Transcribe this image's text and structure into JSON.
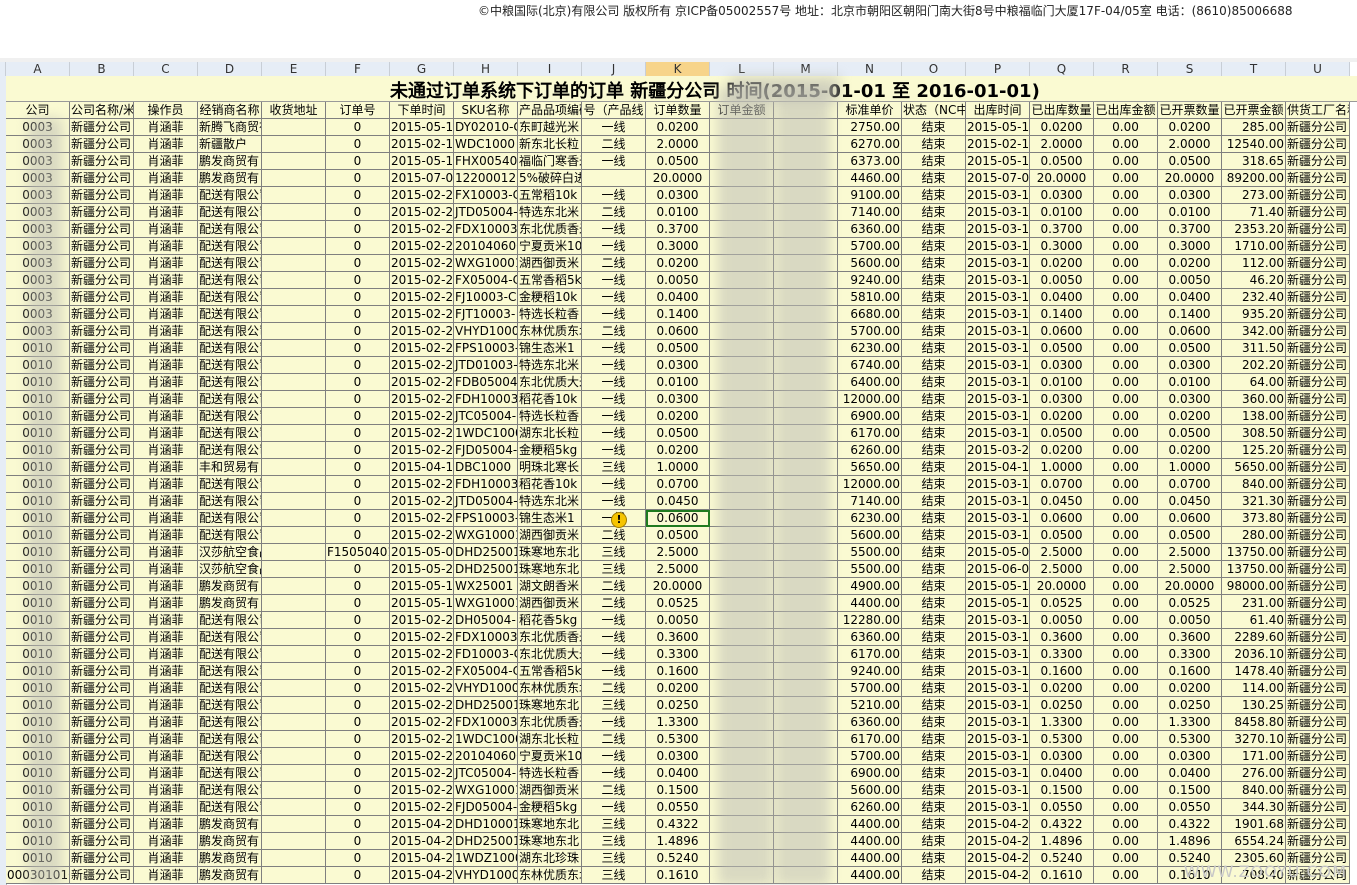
{
  "footer": "©中粮国际(北京)有限公司    版权所有    京ICP备05002557号    地址：北京市朝阳区朝阳门南大街8号中粮福临门大厦17F-04/05室    电话：(8610)85006688",
  "columns": [
    "A",
    "B",
    "C",
    "D",
    "E",
    "F",
    "G",
    "H",
    "I",
    "J",
    "K",
    "L",
    "M",
    "N",
    "O",
    "P",
    "Q",
    "R",
    "S",
    "T",
    "U"
  ],
  "selected_column": "K",
  "sheet_title": "未通过订单系统下订单的订单 新疆分公司 时间(2015-01-01 至 2016-01-01)",
  "headers": [
    "公司",
    "公司名称/米",
    "操作员",
    "经销商名称",
    "收货地址",
    "订单号",
    "下单时间",
    "SKU名称",
    "产品品项编码",
    "号（产品线",
    "订单数量",
    "订单金额",
    "",
    "标准单价",
    "状态（NC中",
    "出库时间",
    "已出库数量",
    "已出库金额",
    "已开票数量",
    "已开票金额",
    "供货工厂名称"
  ],
  "rows": [
    [
      "0003",
      "新疆分公司",
      "肖涵菲",
      "新腾飞商贸有",
      "",
      "0",
      "2015-05-14",
      "DY02010-C",
      "东町越光米",
      "一线",
      "0.0200",
      "",
      "",
      "2750.00",
      "结束",
      "2015-05-14",
      "0.0200",
      "0.00",
      "0.0200",
      "285.00",
      "新疆分公司"
    ],
    [
      "0003",
      "新疆分公司",
      "肖涵菲",
      "新疆散户",
      "",
      "0",
      "2015-02-10",
      "WDC1000",
      "新东北长粒",
      "二线",
      "2.0000",
      "",
      "",
      "6270.00",
      "结束",
      "2015-02-11",
      "2.0000",
      "0.00",
      "2.0000",
      "12540.00",
      "新疆分公司"
    ],
    [
      "0003",
      "新疆分公司",
      "肖涵菲",
      "鹏发商贸有",
      "",
      "0",
      "2015-05-12",
      "FHX00540",
      "福临门寒香米",
      "一线",
      "0.0500",
      "",
      "",
      "6373.00",
      "结束",
      "2015-05-13",
      "0.0500",
      "0.00",
      "0.0500",
      "318.65",
      "新疆分公司"
    ],
    [
      "0003",
      "新疆分公司",
      "肖涵菲",
      "鹏发商贸有",
      "",
      "0",
      "2015-07-01",
      "12200012",
      "5%破碎白进口米贸易",
      "",
      "20.0000",
      "",
      "",
      "4460.00",
      "结束",
      "2015-07-01",
      "20.0000",
      "0.00",
      "20.0000",
      "89200.00",
      "新疆分公司"
    ],
    [
      "0003",
      "新疆分公司",
      "肖涵菲",
      "配送有限公司",
      "",
      "0",
      "2015-02-28",
      "FX10003-C",
      "五常稻10k",
      "一线",
      "0.0300",
      "",
      "",
      "9100.00",
      "结束",
      "2015-03-18",
      "0.0300",
      "0.00",
      "0.0300",
      "273.00",
      "新疆分公司"
    ],
    [
      "0003",
      "新疆分公司",
      "肖涵菲",
      "配送有限公司",
      "",
      "0",
      "2015-02-28",
      "JTD05004-",
      "特选东北米",
      "二线",
      "0.0100",
      "",
      "",
      "7140.00",
      "结束",
      "2015-03-18",
      "0.0100",
      "0.00",
      "0.0100",
      "71.40",
      "新疆分公司"
    ],
    [
      "0003",
      "新疆分公司",
      "肖涵菲",
      "配送有限公司",
      "",
      "0",
      "2015-02-28",
      "FDX10003-",
      "东北优质香米",
      "一线",
      "0.3700",
      "",
      "",
      "6360.00",
      "结束",
      "2015-03-18",
      "0.3700",
      "0.00",
      "0.3700",
      "2353.20",
      "新疆分公司"
    ],
    [
      "0003",
      "新疆分公司",
      "肖涵菲",
      "配送有限公司",
      "",
      "0",
      "2015-02-28",
      "201040600",
      "宁夏贡米10",
      "一线",
      "0.3000",
      "",
      "",
      "5700.00",
      "结束",
      "2015-03-18",
      "0.3000",
      "0.00",
      "0.3000",
      "1710.00",
      "新疆分公司"
    ],
    [
      "0003",
      "新疆分公司",
      "肖涵菲",
      "配送有限公司",
      "",
      "0",
      "2015-02-28",
      "WXG10001",
      "湖西御贡米",
      "二线",
      "0.0200",
      "",
      "",
      "5600.00",
      "结束",
      "2015-03-18",
      "0.0200",
      "0.00",
      "0.0200",
      "112.00",
      "新疆分公司"
    ],
    [
      "0003",
      "新疆分公司",
      "肖涵菲",
      "配送有限公司",
      "",
      "0",
      "2015-02-28",
      "FX05004-C",
      "五常香稻5kg",
      "一线",
      "0.0050",
      "",
      "",
      "9240.00",
      "结束",
      "2015-03-18",
      "0.0050",
      "0.00",
      "0.0050",
      "46.20",
      "新疆分公司"
    ],
    [
      "0003",
      "新疆分公司",
      "肖涵菲",
      "配送有限公司",
      "",
      "0",
      "2015-02-28",
      "FJ10003-C",
      "金粳稻10k",
      "一线",
      "0.0400",
      "",
      "",
      "5810.00",
      "结束",
      "2015-03-18",
      "0.0400",
      "0.00",
      "0.0400",
      "232.40",
      "新疆分公司"
    ],
    [
      "0003",
      "新疆分公司",
      "肖涵菲",
      "配送有限公司",
      "",
      "0",
      "2015-02-28",
      "FJT10003-",
      "特选长粒香",
      "一线",
      "0.1400",
      "",
      "",
      "6680.00",
      "结束",
      "2015-03-18",
      "0.1400",
      "0.00",
      "0.1400",
      "935.20",
      "新疆分公司"
    ],
    [
      "0003",
      "新疆分公司",
      "肖涵菲",
      "配送有限公司",
      "",
      "0",
      "2015-02-28",
      "VHYD1000",
      "东林优质东北",
      "二线",
      "0.0600",
      "",
      "",
      "5700.00",
      "结束",
      "2015-03-18",
      "0.0600",
      "0.00",
      "0.0600",
      "342.00",
      "新疆分公司"
    ],
    [
      "0010",
      "新疆分公司",
      "肖涵菲",
      "配送有限公司",
      "",
      "0",
      "2015-02-28",
      "FPS10003-",
      "锦生态米1",
      "一线",
      "0.0500",
      "",
      "",
      "6230.00",
      "结束",
      "2015-03-18",
      "0.0500",
      "0.00",
      "0.0500",
      "311.50",
      "新疆分公司"
    ],
    [
      "0010",
      "新疆分公司",
      "肖涵菲",
      "配送有限公司",
      "",
      "0",
      "2015-02-28",
      "JTD01003-",
      "特选东北米",
      "一线",
      "0.0300",
      "",
      "",
      "6740.00",
      "结束",
      "2015-03-18",
      "0.0300",
      "0.00",
      "0.0300",
      "202.20",
      "新疆分公司"
    ],
    [
      "0010",
      "新疆分公司",
      "肖涵菲",
      "配送有限公司",
      "",
      "0",
      "2015-02-28",
      "FDB05004",
      "东北优质大米",
      "一线",
      "0.0100",
      "",
      "",
      "6400.00",
      "结束",
      "2015-03-18",
      "0.0100",
      "0.00",
      "0.0100",
      "64.00",
      "新疆分公司"
    ],
    [
      "0010",
      "新疆分公司",
      "肖涵菲",
      "配送有限公司",
      "",
      "0",
      "2015-02-28",
      "FDH10003-",
      "稻花香10k",
      "一线",
      "0.0300",
      "",
      "",
      "12000.00",
      "结束",
      "2015-03-18",
      "0.0300",
      "0.00",
      "0.0300",
      "360.00",
      "新疆分公司"
    ],
    [
      "0010",
      "新疆分公司",
      "肖涵菲",
      "配送有限公司",
      "",
      "0",
      "2015-02-28",
      "JTC05004-",
      "特选长粒香",
      "一线",
      "0.0200",
      "",
      "",
      "6900.00",
      "结束",
      "2015-03-18",
      "0.0200",
      "0.00",
      "0.0200",
      "138.00",
      "新疆分公司"
    ],
    [
      "0010",
      "新疆分公司",
      "肖涵菲",
      "配送有限公司",
      "",
      "0",
      "2015-02-28",
      "1WDC1000",
      "湖东北长粒",
      "一线",
      "0.0500",
      "",
      "",
      "6170.00",
      "结束",
      "2015-03-18",
      "0.0500",
      "0.00",
      "0.0500",
      "308.50",
      "新疆分公司"
    ],
    [
      "0010",
      "新疆分公司",
      "肖涵菲",
      "配送有限公司",
      "",
      "0",
      "2015-02-28",
      "FJD05004-",
      "金粳稻5kg",
      "一线",
      "0.0200",
      "",
      "",
      "6260.00",
      "结束",
      "2015-03-24",
      "0.0200",
      "0.00",
      "0.0200",
      "125.20",
      "新疆分公司"
    ],
    [
      "0010",
      "新疆分公司",
      "肖涵菲",
      "丰和贸易有",
      "",
      "0",
      "2015-04-16",
      "DBC1000",
      "明珠北寒长",
      "三线",
      "1.0000",
      "",
      "",
      "5650.00",
      "结束",
      "2015-04-17",
      "1.0000",
      "0.00",
      "1.0000",
      "5650.00",
      "新疆分公司"
    ],
    [
      "0010",
      "新疆分公司",
      "肖涵菲",
      "配送有限公司",
      "",
      "0",
      "2015-02-28",
      "FDH10003-",
      "稻花香10k",
      "一线",
      "0.0700",
      "",
      "",
      "12000.00",
      "结束",
      "2015-03-18",
      "0.0700",
      "0.00",
      "0.0700",
      "840.00",
      "新疆分公司"
    ],
    [
      "0010",
      "新疆分公司",
      "肖涵菲",
      "配送有限公司",
      "",
      "0",
      "2015-02-28",
      "JTD05004-",
      "特选东北米",
      "一线",
      "0.0450",
      "",
      "",
      "7140.00",
      "结束",
      "2015-03-18",
      "0.0450",
      "0.00",
      "0.0450",
      "321.30",
      "新疆分公司"
    ],
    [
      "0010",
      "新疆分公司",
      "肖涵菲",
      "配送有限公司",
      "",
      "0",
      "2015-02-28",
      "FPS10003-",
      "锦生态米1",
      "一线",
      "0.0600",
      "",
      "",
      "6230.00",
      "结束",
      "2015-03-18",
      "0.0600",
      "0.00",
      "0.0600",
      "373.80",
      "新疆分公司"
    ],
    [
      "0010",
      "新疆分公司",
      "肖涵菲",
      "配送有限公司",
      "",
      "0",
      "2015-02-28",
      "WXG10001",
      "湖西御贡米",
      "二线",
      "0.0500",
      "",
      "",
      "5600.00",
      "结束",
      "2015-03-18",
      "0.0500",
      "0.00",
      "0.0500",
      "280.00",
      "新疆分公司"
    ],
    [
      "0010",
      "新疆分公司",
      "肖涵菲",
      "汉莎航空食品",
      "",
      "F15050401",
      "2015-05-04",
      "DHD25001",
      "珠寒地东北",
      "三线",
      "2.5000",
      "",
      "",
      "5500.00",
      "结束",
      "2015-05-07",
      "2.5000",
      "0.00",
      "2.5000",
      "13750.00",
      "新疆分公司"
    ],
    [
      "0010",
      "新疆分公司",
      "肖涵菲",
      "汉莎航空食品",
      "",
      "0",
      "2015-05-29",
      "DHD25001",
      "珠寒地东北",
      "三线",
      "2.5000",
      "",
      "",
      "5500.00",
      "结束",
      "2015-06-01",
      "2.5000",
      "0.00",
      "2.5000",
      "13750.00",
      "新疆分公司"
    ],
    [
      "0010",
      "新疆分公司",
      "肖涵菲",
      "鹏发商贸有",
      "",
      "0",
      "2015-05-15",
      "WX25001",
      "湖文朗香米",
      "二线",
      "20.0000",
      "",
      "",
      "4900.00",
      "结束",
      "2015-05-19",
      "20.0000",
      "0.00",
      "20.0000",
      "98000.00",
      "新疆分公司"
    ],
    [
      "0010",
      "新疆分公司",
      "肖涵菲",
      "鹏发商贸有",
      "",
      "0",
      "2015-05-13",
      "WXG10001",
      "湖西御贡米",
      "二线",
      "0.0525",
      "",
      "",
      "4400.00",
      "结束",
      "2015-05-13",
      "0.0525",
      "0.00",
      "0.0525",
      "231.00",
      "新疆分公司"
    ],
    [
      "0010",
      "新疆分公司",
      "肖涵菲",
      "配送有限公司",
      "",
      "0",
      "2015-02-28",
      "DH05004-",
      "稻花香5kg",
      "一线",
      "0.0050",
      "",
      "",
      "12280.00",
      "结束",
      "2015-03-18",
      "0.0050",
      "0.00",
      "0.0050",
      "61.40",
      "新疆分公司"
    ],
    [
      "0010",
      "新疆分公司",
      "肖涵菲",
      "配送有限公司",
      "",
      "0",
      "2015-02-28",
      "FDX10003-",
      "东北优质香米",
      "一线",
      "0.3600",
      "",
      "",
      "6360.00",
      "结束",
      "2015-03-18",
      "0.3600",
      "0.00",
      "0.3600",
      "2289.60",
      "新疆分公司"
    ],
    [
      "0010",
      "新疆分公司",
      "肖涵菲",
      "配送有限公司",
      "",
      "0",
      "2015-02-28",
      "FD10003-C",
      "东北优质大米",
      "一线",
      "0.3300",
      "",
      "",
      "6170.00",
      "结束",
      "2015-03-18",
      "0.3300",
      "0.00",
      "0.3300",
      "2036.10",
      "新疆分公司"
    ],
    [
      "0010",
      "新疆分公司",
      "肖涵菲",
      "配送有限公司",
      "",
      "0",
      "2015-02-28",
      "FX05004-C",
      "五常香稻5kg",
      "一线",
      "0.1600",
      "",
      "",
      "9240.00",
      "结束",
      "2015-03-18",
      "0.1600",
      "0.00",
      "0.1600",
      "1478.40",
      "新疆分公司"
    ],
    [
      "0010",
      "新疆分公司",
      "肖涵菲",
      "配送有限公司",
      "",
      "0",
      "2015-02-28",
      "VHYD1000",
      "东林优质东北",
      "二线",
      "0.0200",
      "",
      "",
      "5700.00",
      "结束",
      "2015-03-18",
      "0.0200",
      "0.00",
      "0.0200",
      "114.00",
      "新疆分公司"
    ],
    [
      "0010",
      "新疆分公司",
      "肖涵菲",
      "配送有限公司",
      "",
      "0",
      "2015-02-28",
      "DHD25001",
      "珠寒地东北",
      "三线",
      "0.0250",
      "",
      "",
      "5210.00",
      "结束",
      "2015-03-18",
      "0.0250",
      "0.00",
      "0.0250",
      "130.25",
      "新疆分公司"
    ],
    [
      "0010",
      "新疆分公司",
      "肖涵菲",
      "配送有限公司",
      "",
      "0",
      "2015-02-28",
      "FDX10003-",
      "东北优质香米",
      "一线",
      "1.3300",
      "",
      "",
      "6360.00",
      "结束",
      "2015-03-18",
      "1.3300",
      "0.00",
      "1.3300",
      "8458.80",
      "新疆分公司"
    ],
    [
      "0010",
      "新疆分公司",
      "肖涵菲",
      "配送有限公司",
      "",
      "0",
      "2015-02-28",
      "1WDC1000",
      "湖东北长粒",
      "二线",
      "0.5300",
      "",
      "",
      "6170.00",
      "结束",
      "2015-03-18",
      "0.5300",
      "0.00",
      "0.5300",
      "3270.10",
      "新疆分公司"
    ],
    [
      "0010",
      "新疆分公司",
      "肖涵菲",
      "配送有限公司",
      "",
      "0",
      "2015-02-28",
      "201040600",
      "宁夏贡米10",
      "一线",
      "0.0300",
      "",
      "",
      "5700.00",
      "结束",
      "2015-03-18",
      "0.0300",
      "0.00",
      "0.0300",
      "171.00",
      "新疆分公司"
    ],
    [
      "0010",
      "新疆分公司",
      "肖涵菲",
      "配送有限公司",
      "",
      "0",
      "2015-02-28",
      "JTC05004-",
      "特选长粒香",
      "一线",
      "0.0400",
      "",
      "",
      "6900.00",
      "结束",
      "2015-03-18",
      "0.0400",
      "0.00",
      "0.0400",
      "276.00",
      "新疆分公司"
    ],
    [
      "0010",
      "新疆分公司",
      "肖涵菲",
      "配送有限公司",
      "",
      "0",
      "2015-02-28",
      "WXG10001",
      "湖西御贡米",
      "二线",
      "0.1500",
      "",
      "",
      "5600.00",
      "结束",
      "2015-03-18",
      "0.1500",
      "0.00",
      "0.1500",
      "840.00",
      "新疆分公司"
    ],
    [
      "0010",
      "新疆分公司",
      "肖涵菲",
      "配送有限公司",
      "",
      "0",
      "2015-02-28",
      "FJD05004-",
      "金粳稻5kg",
      "一线",
      "0.0550",
      "",
      "",
      "6260.00",
      "结束",
      "2015-03-18",
      "0.0550",
      "0.00",
      "0.0550",
      "344.30",
      "新疆分公司"
    ],
    [
      "0010",
      "新疆分公司",
      "肖涵菲",
      "鹏发商贸有",
      "",
      "0",
      "2015-04-20",
      "DHD10001",
      "珠寒地东北",
      "三线",
      "0.4322",
      "",
      "",
      "4400.00",
      "结束",
      "2015-04-21",
      "0.4322",
      "0.00",
      "0.4322",
      "1901.68",
      "新疆分公司"
    ],
    [
      "0010",
      "新疆分公司",
      "肖涵菲",
      "鹏发商贸有",
      "",
      "0",
      "2015-04-20",
      "DHD25001",
      "珠寒地东北",
      "三线",
      "1.4896",
      "",
      "",
      "4400.00",
      "结束",
      "2015-04-21",
      "1.4896",
      "0.00",
      "1.4896",
      "6554.24",
      "新疆分公司"
    ],
    [
      "0010",
      "新疆分公司",
      "肖涵菲",
      "鹏发商贸有",
      "",
      "0",
      "2015-04-20",
      "1WDZ1000",
      "湖东北珍珠",
      "三线",
      "0.5240",
      "",
      "",
      "4400.00",
      "结束",
      "2015-04-21",
      "0.5240",
      "0.00",
      "0.5240",
      "2305.60",
      "新疆分公司"
    ],
    [
      "0003010103",
      "新疆分公司",
      "肖涵菲",
      "鹏发商贸有",
      "",
      "0",
      "2015-04-20",
      "VHYD1000",
      "东林优质东北",
      "三线",
      "0.1610",
      "",
      "",
      "4400.00",
      "结束",
      "2015-04-21",
      "0.1610",
      "0.00",
      "0.1610",
      "708.40",
      "新疆分公司"
    ]
  ],
  "watermark": "WWW.ZOOYU.COM",
  "warning_symbol": "!"
}
